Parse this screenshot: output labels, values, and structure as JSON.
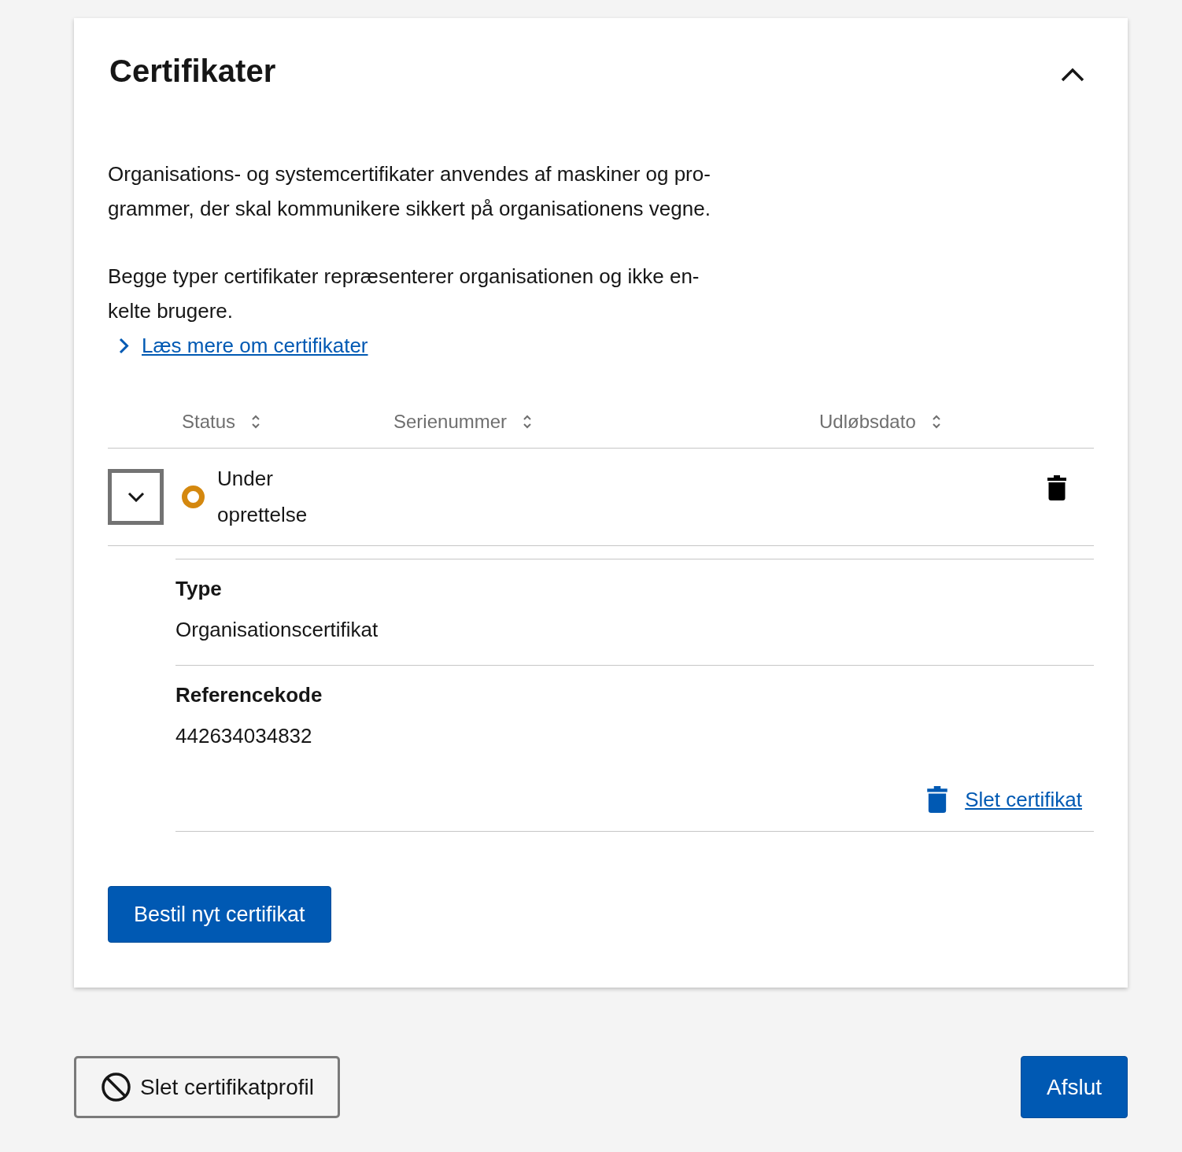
{
  "panel": {
    "title": "Certifikater",
    "expanded": true
  },
  "description": [
    "Organisations- og systemcertifikater anvendes af maskiner og pro-\ngrammer, der skal kommunikere sikkert på organisationens vegne.",
    "Begge typer certifikater repræsenterer organisationen og ikke en-\nkelte brugere."
  ],
  "read_more_link": "Læs mere om certifikater",
  "table": {
    "columns": [
      "Status",
      "Serienummer",
      "Udløbsdato"
    ],
    "rows": [
      {
        "expanded": true,
        "status": {
          "label": "Under oprettelse",
          "color": "#d4880f"
        },
        "details": [
          {
            "label": "Type",
            "value": "Organisationscertifikat"
          },
          {
            "label": "Referencekode",
            "value": "442634034832"
          }
        ],
        "delete_link": "Slet certifikat"
      }
    ]
  },
  "order_button": "Bestil nyt certifikat",
  "footer_buttons": [
    {
      "label": "Slet certifikatprofil",
      "kind": "secondary"
    },
    {
      "label": "Afslut",
      "kind": "primary"
    }
  ]
}
